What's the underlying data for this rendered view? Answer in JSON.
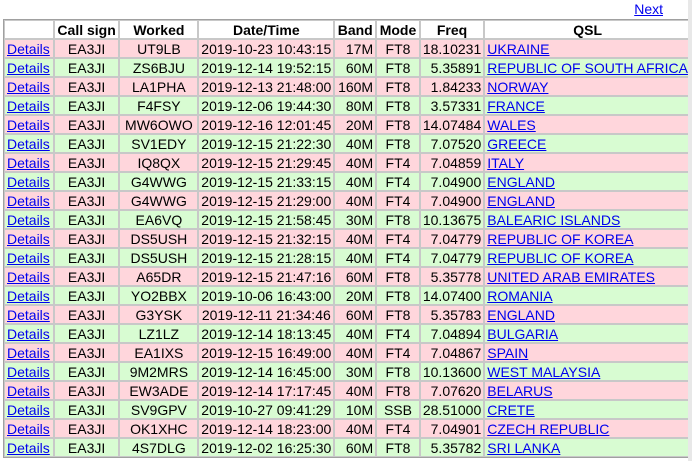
{
  "nav": {
    "next_label": "Next"
  },
  "headers": [
    "",
    "Call sign",
    "Worked",
    "Date/Time",
    "Band",
    "Mode",
    "Freq",
    "QSL"
  ],
  "rows": [
    {
      "details": "Details",
      "call": "EA3JI",
      "worked": "UT9LB",
      "datetime": "2019-10-23 10:43:15",
      "band": "17M",
      "mode": "FT8",
      "freq": "18.10231",
      "qsl": "UKRAINE",
      "color": "pink"
    },
    {
      "details": "Details",
      "call": "EA3JI",
      "worked": "ZS6BJU",
      "datetime": "2019-12-14 19:52:15",
      "band": "60M",
      "mode": "FT8",
      "freq": "5.35891",
      "qsl": "REPUBLIC OF SOUTH AFRICA",
      "color": "green"
    },
    {
      "details": "Details",
      "call": "EA3JI",
      "worked": "LA1PHA",
      "datetime": "2019-12-13 21:48:00",
      "band": "160M",
      "mode": "FT8",
      "freq": "1.84233",
      "qsl": "NORWAY",
      "color": "pink"
    },
    {
      "details": "Details",
      "call": "EA3JI",
      "worked": "F4FSY",
      "datetime": "2019-12-06 19:44:30",
      "band": "80M",
      "mode": "FT8",
      "freq": "3.57331",
      "qsl": "FRANCE",
      "color": "green"
    },
    {
      "details": "Details",
      "call": "EA3JI",
      "worked": "MW6OWO",
      "datetime": "2019-12-16 12:01:45",
      "band": "20M",
      "mode": "FT8",
      "freq": "14.07484",
      "qsl": "WALES",
      "color": "pink"
    },
    {
      "details": "Details",
      "call": "EA3JI",
      "worked": "SV1EDY",
      "datetime": "2019-12-15 21:22:30",
      "band": "40M",
      "mode": "FT8",
      "freq": "7.07520",
      "qsl": "GREECE",
      "color": "green"
    },
    {
      "details": "Details",
      "call": "EA3JI",
      "worked": "IQ8QX",
      "datetime": "2019-12-15 21:29:45",
      "band": "40M",
      "mode": "FT4",
      "freq": "7.04859",
      "qsl": "ITALY",
      "color": "pink"
    },
    {
      "details": "Details",
      "call": "EA3JI",
      "worked": "G4WWG",
      "datetime": "2019-12-15 21:33:15",
      "band": "40M",
      "mode": "FT4",
      "freq": "7.04900",
      "qsl": "ENGLAND",
      "color": "green"
    },
    {
      "details": "Details",
      "call": "EA3JI",
      "worked": "G4WWG",
      "datetime": "2019-12-15 21:29:00",
      "band": "40M",
      "mode": "FT4",
      "freq": "7.04900",
      "qsl": "ENGLAND",
      "color": "pink"
    },
    {
      "details": "Details",
      "call": "EA3JI",
      "worked": "EA6VQ",
      "datetime": "2019-12-15 21:58:45",
      "band": "30M",
      "mode": "FT8",
      "freq": "10.13675",
      "qsl": "BALEARIC ISLANDS",
      "color": "green"
    },
    {
      "details": "Details",
      "call": "EA3JI",
      "worked": "DS5USH",
      "datetime": "2019-12-15 21:32:15",
      "band": "40M",
      "mode": "FT4",
      "freq": "7.04779",
      "qsl": "REPUBLIC OF KOREA",
      "color": "pink"
    },
    {
      "details": "Details",
      "call": "EA3JI",
      "worked": "DS5USH",
      "datetime": "2019-12-15 21:28:15",
      "band": "40M",
      "mode": "FT4",
      "freq": "7.04779",
      "qsl": "REPUBLIC OF KOREA",
      "color": "green"
    },
    {
      "details": "Details",
      "call": "EA3JI",
      "worked": "A65DR",
      "datetime": "2019-12-15 21:47:16",
      "band": "60M",
      "mode": "FT8",
      "freq": "5.35778",
      "qsl": "UNITED ARAB EMIRATES",
      "color": "pink"
    },
    {
      "details": "Details",
      "call": "EA3JI",
      "worked": "YO2BBX",
      "datetime": "2019-10-06 16:43:00",
      "band": "20M",
      "mode": "FT8",
      "freq": "14.07400",
      "qsl": "ROMANIA",
      "color": "green"
    },
    {
      "details": "Details",
      "call": "EA3JI",
      "worked": "G3YSK",
      "datetime": "2019-12-11 21:34:46",
      "band": "60M",
      "mode": "FT8",
      "freq": "5.35783",
      "qsl": "ENGLAND",
      "color": "pink"
    },
    {
      "details": "Details",
      "call": "EA3JI",
      "worked": "LZ1LZ",
      "datetime": "2019-12-14 18:13:45",
      "band": "40M",
      "mode": "FT4",
      "freq": "7.04894",
      "qsl": "BULGARIA",
      "color": "green"
    },
    {
      "details": "Details",
      "call": "EA3JI",
      "worked": "EA1IXS",
      "datetime": "2019-12-15 16:49:00",
      "band": "40M",
      "mode": "FT4",
      "freq": "7.04867",
      "qsl": "SPAIN",
      "color": "pink"
    },
    {
      "details": "Details",
      "call": "EA3JI",
      "worked": "9M2MRS",
      "datetime": "2019-12-14 16:45:00",
      "band": "30M",
      "mode": "FT8",
      "freq": "10.13600",
      "qsl": "WEST MALAYSIA",
      "color": "green"
    },
    {
      "details": "Details",
      "call": "EA3JI",
      "worked": "EW3ADE",
      "datetime": "2019-12-14 17:17:45",
      "band": "40M",
      "mode": "FT8",
      "freq": "7.07620",
      "qsl": "BELARUS",
      "color": "pink"
    },
    {
      "details": "Details",
      "call": "EA3JI",
      "worked": "SV9GPV",
      "datetime": "2019-10-27 09:41:29",
      "band": "10M",
      "mode": "SSB",
      "freq": "28.51000",
      "qsl": "CRETE",
      "color": "green"
    },
    {
      "details": "Details",
      "call": "EA3JI",
      "worked": "OK1XHC",
      "datetime": "2019-12-14 18:23:00",
      "band": "40M",
      "mode": "FT4",
      "freq": "7.04901",
      "qsl": "CZECH REPUBLIC",
      "color": "pink"
    },
    {
      "details": "Details",
      "call": "EA3JI",
      "worked": "4S7DLG",
      "datetime": "2019-12-02 16:25:30",
      "band": "60M",
      "mode": "FT8",
      "freq": "5.35782",
      "qsl": "SRI LANKA",
      "color": "green"
    }
  ]
}
